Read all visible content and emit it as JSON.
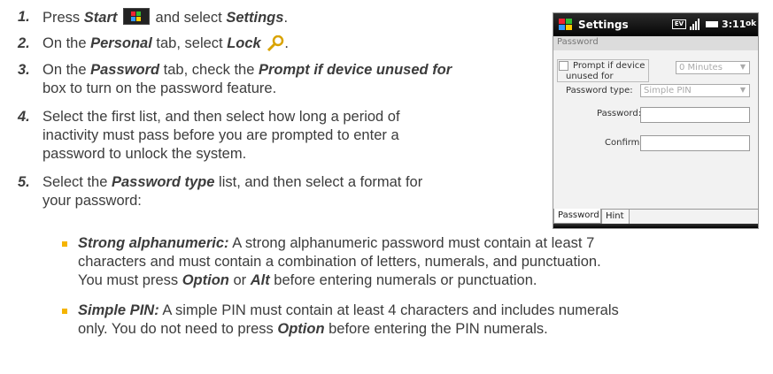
{
  "steps": [
    {
      "num": "1.",
      "text1": "Press ",
      "start": "Start",
      "text2": " and select ",
      "settings": "Settings",
      "text3": "."
    },
    {
      "num": "2.",
      "text1": "On the ",
      "personal": "Personal",
      "text2": " tab, select ",
      "lock": "Lock",
      "text3": "."
    },
    {
      "num": "3.",
      "line1a": "On the ",
      "password_tab": "Password",
      "line1b": " tab, check the ",
      "prompt": "Prompt if device unused for",
      "line2": "box to turn on the password feature."
    },
    {
      "num": "4.",
      "line1": "Select the first list, and then select how long a period of",
      "line2": "inactivity must pass before you are prompted to enter a",
      "line3": "password to unlock the system."
    },
    {
      "num": "5.",
      "line1a": "Select the ",
      "pw_type": "Password type",
      "line1b": " list, and then select a format for",
      "line2": "your password:"
    }
  ],
  "bullets": [
    {
      "term": "Strong alphanumeric:",
      "line1": " A strong alphanumeric password must contain at least 7",
      "line2": "characters and must contain a combination of letters, numerals, and punctuation.",
      "line3a": "You must press ",
      "option": "Option",
      "or": " or ",
      "alt": "Alt",
      "line3b": " before entering numerals or punctuation."
    },
    {
      "term": "Simple PIN:",
      "line1": " A simple PIN must contain at least 4 characters and includes numerals",
      "line2a": "only. You do not need to press ",
      "option": "Option",
      "line2b": " before entering the PIN numerals."
    }
  ],
  "phone": {
    "title": "Settings",
    "time": "3:11",
    "ok": "ok",
    "section": "Password",
    "prompt_label_1": "Prompt if device",
    "prompt_label_2": "unused for",
    "minutes": "0 Minutes",
    "pw_type_label": "Password type:",
    "pw_type_value": "Simple PIN",
    "password_label": "Password:",
    "confirm_label": "Confirm:",
    "tab_password": "Password",
    "tab_hint": "Hint"
  },
  "colors": {
    "bullet": "#f5b400",
    "accent": "#f5b400"
  }
}
